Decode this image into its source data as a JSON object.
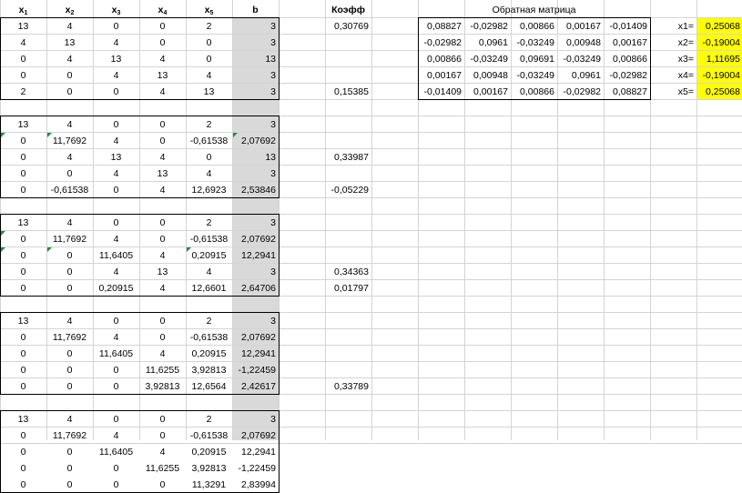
{
  "headers": {
    "x1": "x",
    "x1_sub": "1",
    "x2": "x",
    "x2_sub": "2",
    "x3": "x",
    "x3_sub": "3",
    "x4": "x",
    "x4_sub": "4",
    "x5": "x",
    "x5_sub": "5",
    "b": "b",
    "coef": "Коэфф",
    "inverse_title": "Обратная матрица"
  },
  "blocks": [
    {
      "rows": [
        [
          "13",
          "4",
          "0",
          "0",
          "2",
          "3"
        ],
        [
          "4",
          "13",
          "4",
          "0",
          "0",
          "3"
        ],
        [
          "0",
          "4",
          "13",
          "4",
          "0",
          "13"
        ],
        [
          "0",
          "0",
          "4",
          "13",
          "4",
          "3"
        ],
        [
          "2",
          "0",
          "0",
          "4",
          "13",
          "3"
        ]
      ],
      "coef": [
        "0,30769",
        "",
        "",
        "",
        "0,15385"
      ],
      "marks": []
    },
    {
      "rows": [
        [
          "13",
          "4",
          "0",
          "0",
          "2",
          "3"
        ],
        [
          "0",
          "11,7692",
          "4",
          "0",
          "-0,61538",
          "2,07692"
        ],
        [
          "0",
          "4",
          "13",
          "4",
          "0",
          "13"
        ],
        [
          "0",
          "0",
          "4",
          "13",
          "4",
          "3"
        ],
        [
          "0",
          "-0,61538",
          "0",
          "4",
          "12,6923",
          "2,53846"
        ]
      ],
      "coef": [
        "",
        "",
        "0,33987",
        "",
        "-0,05229"
      ],
      "marks": [
        [
          1,
          0
        ],
        [
          1,
          1
        ],
        [
          1,
          5
        ]
      ]
    },
    {
      "rows": [
        [
          "13",
          "4",
          "0",
          "0",
          "2",
          "3"
        ],
        [
          "0",
          "11,7692",
          "4",
          "0",
          "-0,61538",
          "2,07692"
        ],
        [
          "0",
          "0",
          "11,6405",
          "4",
          "0,20915",
          "12,2941"
        ],
        [
          "0",
          "0",
          "4",
          "13",
          "4",
          "3"
        ],
        [
          "0",
          "0",
          "0,20915",
          "4",
          "12,6601",
          "2,64706"
        ]
      ],
      "coef": [
        "",
        "",
        "",
        "0,34363",
        "0,01797"
      ],
      "marks": [
        [
          1,
          0
        ],
        [
          2,
          0
        ],
        [
          2,
          1
        ],
        [
          2,
          4
        ]
      ]
    },
    {
      "rows": [
        [
          "13",
          "4",
          "0",
          "0",
          "2",
          "3"
        ],
        [
          "0",
          "11,7692",
          "4",
          "0",
          "-0,61538",
          "2,07692"
        ],
        [
          "0",
          "0",
          "11,6405",
          "4",
          "0,20915",
          "12,2941"
        ],
        [
          "0",
          "0",
          "0",
          "11,6255",
          "3,92813",
          "-1,22459"
        ],
        [
          "0",
          "0",
          "0",
          "3,92813",
          "12,6564",
          "2,42617"
        ]
      ],
      "coef": [
        "",
        "",
        "",
        "",
        "0,33789"
      ],
      "marks": []
    },
    {
      "rows": [
        [
          "13",
          "4",
          "0",
          "0",
          "2",
          "3"
        ],
        [
          "0",
          "11,7692",
          "4",
          "0",
          "-0,61538",
          "2,07692"
        ],
        [
          "0",
          "0",
          "11,6405",
          "4",
          "0,20915",
          "12,2941"
        ],
        [
          "0",
          "0",
          "0",
          "11,6255",
          "3,92813",
          "-1,22459"
        ],
        [
          "0",
          "0",
          "0",
          "0",
          "11,3291",
          "2,83994"
        ]
      ],
      "coef": [
        "",
        "",
        "",
        "",
        ""
      ],
      "marks": []
    }
  ],
  "inverse": [
    [
      "0,08827",
      "-0,02982",
      "0,00866",
      "0,00167",
      "-0,01409"
    ],
    [
      "-0,02982",
      "0,0961",
      "-0,03249",
      "0,00948",
      "0,00167"
    ],
    [
      "0,00866",
      "-0,03249",
      "0,09691",
      "-0,03249",
      "0,00866"
    ],
    [
      "0,00167",
      "0,00948",
      "-0,03249",
      "0,0961",
      "-0,02982"
    ],
    [
      "-0,01409",
      "0,00167",
      "0,00866",
      "-0,02982",
      "0,08827"
    ]
  ],
  "solution": [
    {
      "label": "x1=",
      "value": "0,25068"
    },
    {
      "label": "x2=",
      "value": "-0,19004"
    },
    {
      "label": "x3=",
      "value": "1,11695"
    },
    {
      "label": "x4=",
      "value": "-0,19004"
    },
    {
      "label": "x5=",
      "value": "0,25068"
    }
  ],
  "colors": {
    "b_column_fill": "#d9d9d9",
    "highlight": "#ffff00",
    "gridline": "#d4d4d4",
    "error_marker": "#1e8e3e"
  }
}
